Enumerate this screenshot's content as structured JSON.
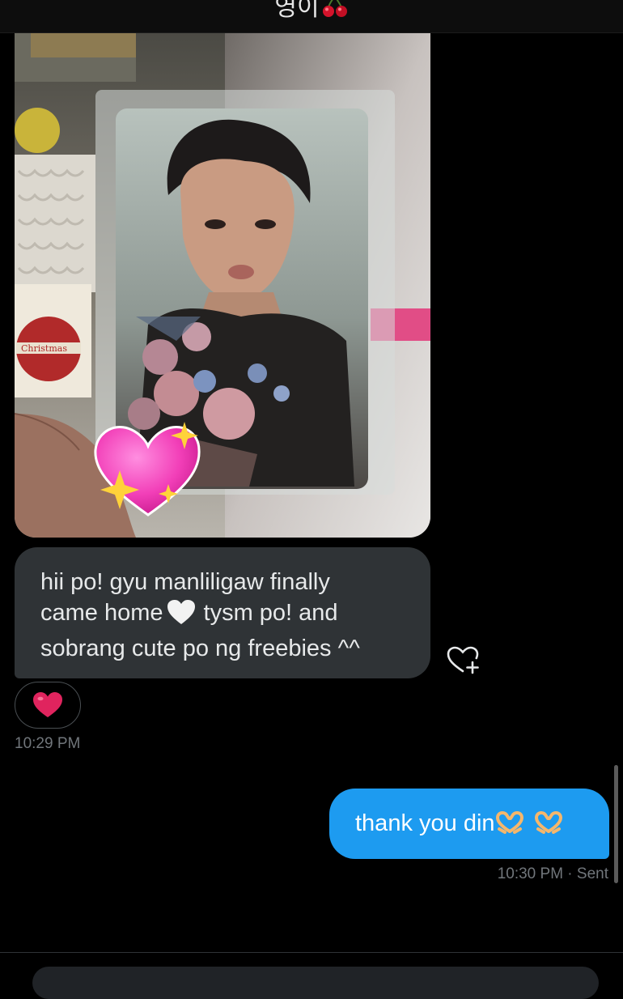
{
  "header": {
    "title": "영이",
    "title_emoji": "cherries-icon"
  },
  "messages": {
    "incoming_photo": {
      "description_icon": "photocard-image",
      "sticker": "sparkling-heart-icon",
      "card_text": "Christmas"
    },
    "incoming_text": {
      "line1": "hii po! gyu manliligaw finally",
      "line2_a": "came home",
      "line2_b": "tysm po! and",
      "line3": "sobrang cute po ng freebies ^^",
      "emoji": "white-heart-icon"
    },
    "incoming_reaction": "red-heart-icon",
    "incoming_time": "10:29 PM",
    "outgoing_text": "thank you din",
    "outgoing_emoji": "heart-hands-icon",
    "outgoing_status": "10:30 PM · Sent"
  },
  "actions": {
    "add_reaction_icon": "heart-plus-icon"
  },
  "colors": {
    "background": "#000000",
    "incoming_bubble": "#2f3336",
    "outgoing_bubble": "#1d9bf0",
    "muted_text": "#71767b",
    "reaction_heart": "#e0245e"
  }
}
